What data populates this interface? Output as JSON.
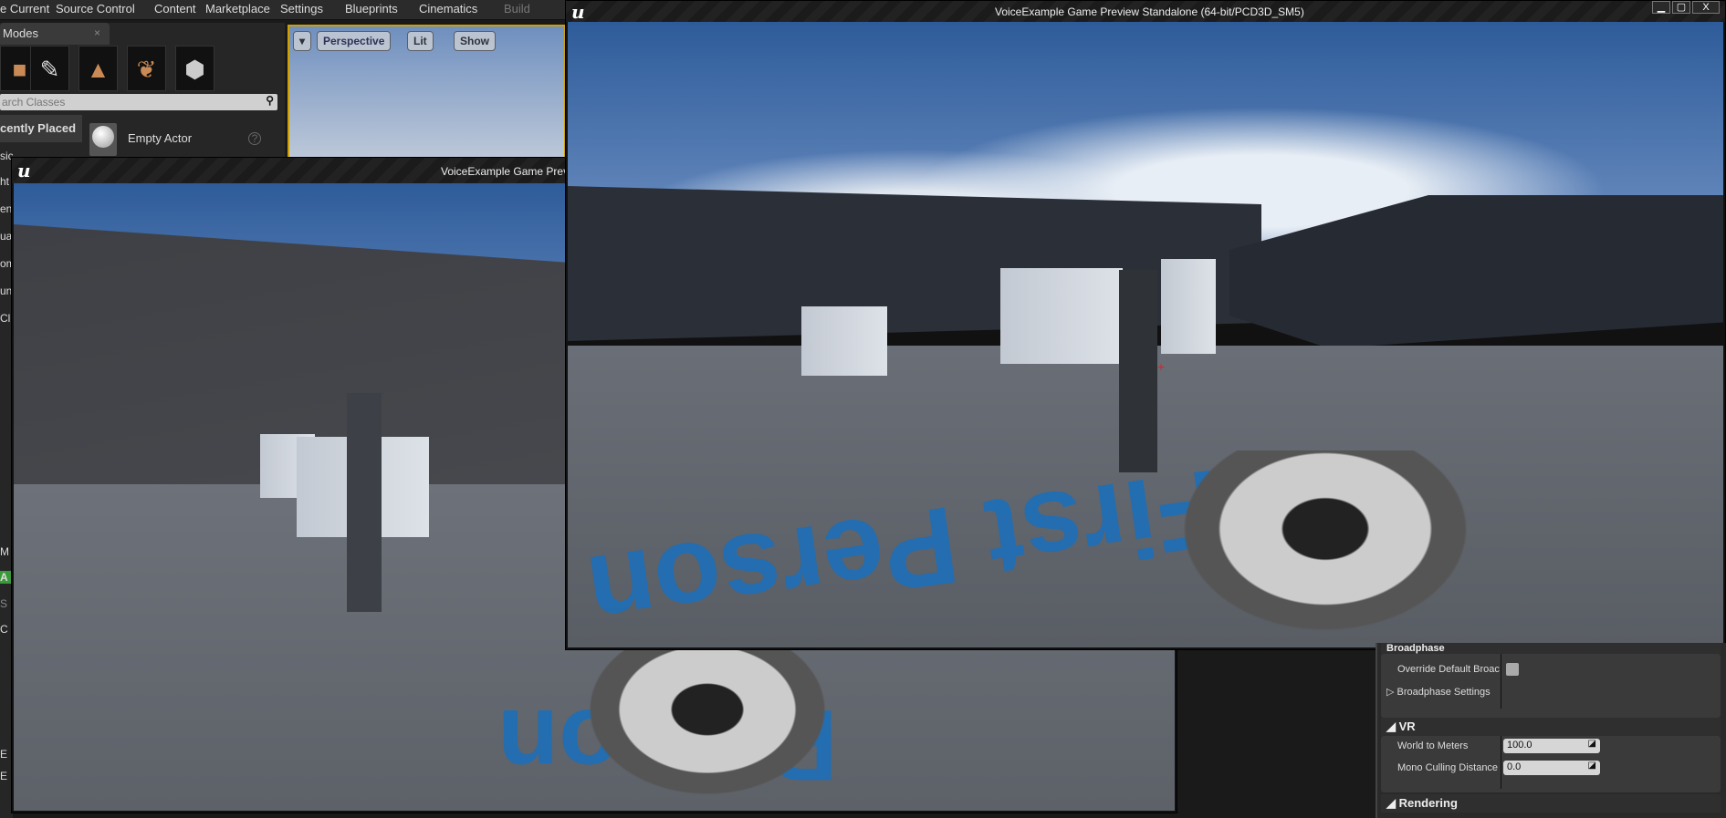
{
  "menubar": {
    "items": [
      "e Current",
      "Source Control",
      "Content",
      "Marketplace",
      "Settings",
      "Blueprints",
      "Cinematics",
      "Build"
    ]
  },
  "modes": {
    "tab_label": "Modes",
    "close": "×",
    "tools": [
      "place-icon",
      "paint-icon",
      "landscape-icon",
      "foliage-icon",
      "geometry-icon"
    ],
    "search_placeholder": "arch Classes",
    "category": "cently Placed",
    "item": "Empty Actor",
    "help": "?"
  },
  "viewport": {
    "buttons": [
      "▾",
      "Perspective",
      "Lit",
      "Show"
    ]
  },
  "left_strip": {
    "items": [
      "sic",
      "ht",
      "en",
      "ua",
      "om",
      "un",
      "Cl",
      "M",
      "A",
      "S",
      "C",
      "E",
      "E"
    ]
  },
  "game_window_back": {
    "title": "VoiceExample Game Preview"
  },
  "game_window_front": {
    "title": "VoiceExample Game Preview Standalone (64-bit/PCD3D_SM5)",
    "controls": [
      "▁",
      "▢",
      "X"
    ]
  },
  "scene": {
    "floor_text_front": "First Person",
    "floor_text_back": "Person"
  },
  "details": {
    "broadphase": {
      "header": "Broadphase",
      "override_label": "Override Default Broac",
      "settings_label": "Broadphase Settings"
    },
    "vr": {
      "header": "VR",
      "world_to_meters_label": "World to Meters",
      "world_to_meters": "100.0",
      "mono_culling_label": "Mono Culling Distance",
      "mono_culling": "0.0"
    },
    "rendering": {
      "header": "Rendering"
    }
  }
}
